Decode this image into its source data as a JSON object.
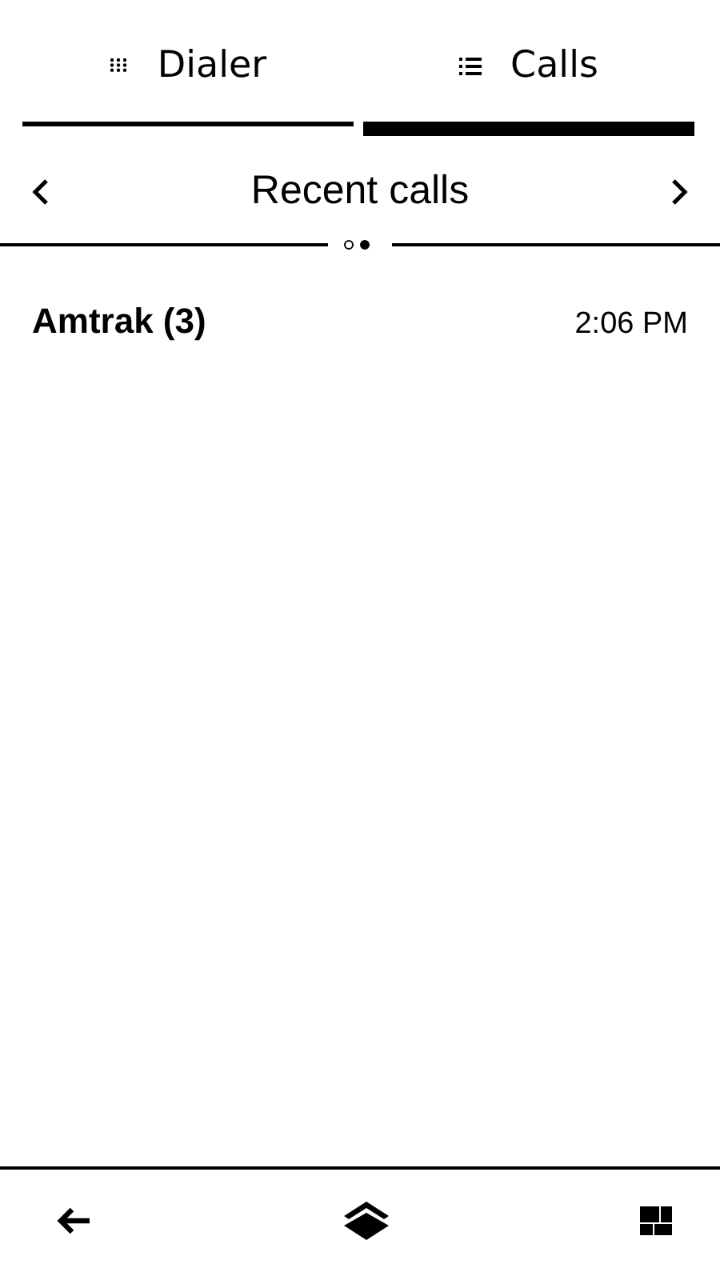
{
  "tabs": [
    {
      "label": "Dialer",
      "kind": "dialer",
      "selected": false
    },
    {
      "label": "Calls",
      "kind": "calls",
      "selected": true
    }
  ],
  "header": {
    "title": "Recent calls"
  },
  "pages": [
    {
      "selected": false
    },
    {
      "selected": true
    }
  ],
  "calls": [
    {
      "name": "Amtrak (3)",
      "time": "2:06 PM"
    }
  ]
}
